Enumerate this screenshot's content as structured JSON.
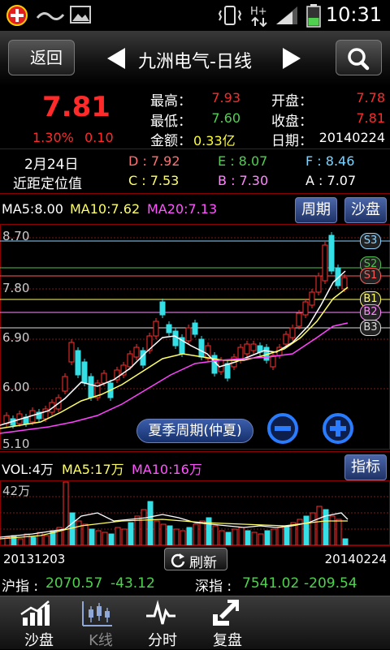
{
  "status": {
    "time": "10:31"
  },
  "nav": {
    "back_label": "返回",
    "title": "九洲电气-日线"
  },
  "quote": {
    "price": "7.81",
    "change_pct": "1.30%",
    "change": "0.10",
    "high_label": "最高：",
    "high": "7.93",
    "low_label": "最低：",
    "low": "7.60",
    "amount_label": "金额：",
    "amount": "0.33亿",
    "open_label": "开盘：",
    "open": "7.78",
    "close_label": "收盘：",
    "close": "7.81",
    "date_label": "日期：",
    "date": "20140224"
  },
  "positioning": {
    "date": "2月24日",
    "label": "近距定位值",
    "D": "D : 7.92",
    "E": "E : 8.07",
    "F": "F : 8.46",
    "C": "C : 7.53",
    "B": "B : 7.30",
    "A": "A : 7.07"
  },
  "ma": {
    "ma5": "MA5:8.00",
    "ma10": "MA10:7.62",
    "ma20": "MA20:7.13",
    "period_btn": "周期",
    "sandpan_btn": "沙盘"
  },
  "kchart": {
    "y_labels": [
      "8.70",
      "7.80",
      "6.90",
      "6.00",
      "5.10"
    ],
    "levels": [
      {
        "name": "S3",
        "color": "#8fd3ff"
      },
      {
        "name": "S2",
        "color": "#4fbf4f"
      },
      {
        "name": "S1",
        "color": "#ff5a5a"
      },
      {
        "name": "B1",
        "color": "#ffff66"
      },
      {
        "name": "B2",
        "color": "#ff88ff"
      },
      {
        "name": "B3",
        "color": "#dddddd"
      }
    ],
    "season_btn": "夏季周期(仲夏)"
  },
  "vol": {
    "vol": "VOL:4万",
    "ma5": "MA5:17万",
    "ma10": "MA10:16万",
    "indicator_btn": "指标",
    "y_label": "42万"
  },
  "dates": {
    "start": "20131203",
    "end": "20140224",
    "refresh": "刷新"
  },
  "index": {
    "sh_label": "沪指 : ",
    "sh_value": "2070.57",
    "sh_change": "-43.12",
    "sz_label": "深指 : ",
    "sz_value": "7541.02",
    "sz_change": "-209.54"
  },
  "tabs": [
    {
      "label": "沙盘",
      "icon": "bar-chart-icon"
    },
    {
      "label": "K线",
      "icon": "candlestick-icon"
    },
    {
      "label": "分时",
      "icon": "pulse-icon"
    },
    {
      "label": "复盘",
      "icon": "replay-arrow-icon"
    }
  ]
}
